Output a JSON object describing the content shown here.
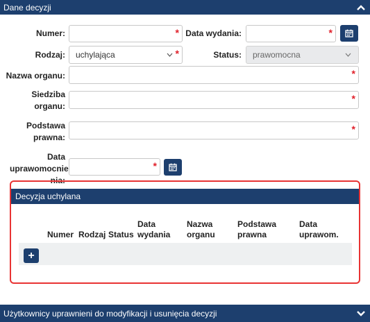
{
  "header": {
    "title": "Dane decyzji"
  },
  "form": {
    "numer_label": "Numer:",
    "numer_value": "",
    "data_wydania_label": "Data wydania:",
    "data_wydania_value": "",
    "rodzaj_label": "Rodzaj:",
    "rodzaj_value": "uchylająca",
    "status_label": "Status:",
    "status_value": "prawomocna",
    "nazwa_organu_label": "Nazwa organu:",
    "siedziba_label_1": "Siedziba",
    "siedziba_label_2": "organu:",
    "podstawa_label_1": "Podstawa",
    "podstawa_label_2": "prawna:",
    "data_uprawom_label_1": "Data",
    "data_uprawom_label_2": "uprawomocnie",
    "data_uprawom_label_3": "nia:",
    "required_mark": "*"
  },
  "panel": {
    "title": "Decyzja uchylana",
    "columns": [
      {
        "line1": "Numer",
        "line2": ""
      },
      {
        "line1": "Rodzaj",
        "line2": ""
      },
      {
        "line1": "Status",
        "line2": ""
      },
      {
        "line1": "Data",
        "line2": "wydania"
      },
      {
        "line1": "Nazwa",
        "line2": "organu"
      },
      {
        "line1": "Podstawa",
        "line2": "prawna"
      },
      {
        "line1": "Data",
        "line2": "uprawom."
      }
    ],
    "add_label": "+"
  },
  "footer": {
    "title": "Użytkownicy uprawnieni do modyfikacji i usunięcia decyzji"
  },
  "icons": {
    "collapse": "chevron-up-icon",
    "expand": "chevron-down-icon",
    "calendar": "calendar-icon",
    "dropdown": "caret-down-icon"
  },
  "colors": {
    "brand": "#1d3f6e",
    "required": "#e0202a",
    "highlight": "#e83333"
  }
}
